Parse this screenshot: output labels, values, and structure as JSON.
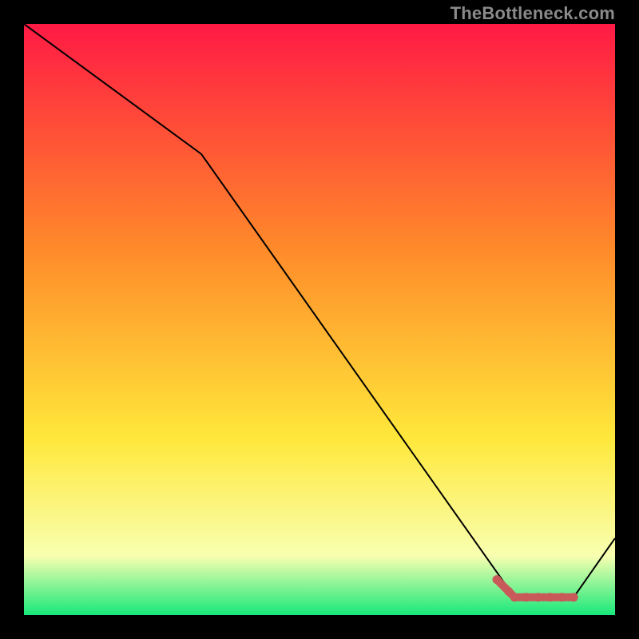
{
  "watermark": "TheBottleneck.com",
  "chart_data": {
    "type": "line",
    "title": "",
    "xlabel": "",
    "ylabel": "",
    "x_range": [
      0,
      100
    ],
    "y_range": [
      0,
      100
    ],
    "series": [
      {
        "name": "line",
        "color": "#000000",
        "stroke_width": 2,
        "x": [
          0,
          30,
          83,
          93,
          100
        ],
        "y": [
          100,
          78,
          3,
          3,
          13
        ]
      },
      {
        "name": "marker-band",
        "color": "#c95a5a",
        "stroke_width": 10,
        "x": [
          80,
          82,
          83,
          85,
          87,
          89,
          91,
          93
        ],
        "y": [
          6,
          4,
          3,
          3,
          3,
          3,
          3,
          3
        ]
      }
    ],
    "background_gradient": {
      "top": "#ff1a44",
      "mid1": "#ff8a2a",
      "mid2": "#ffe83a",
      "mid3": "#f8ffb0",
      "bottom": "#17e87a"
    }
  }
}
